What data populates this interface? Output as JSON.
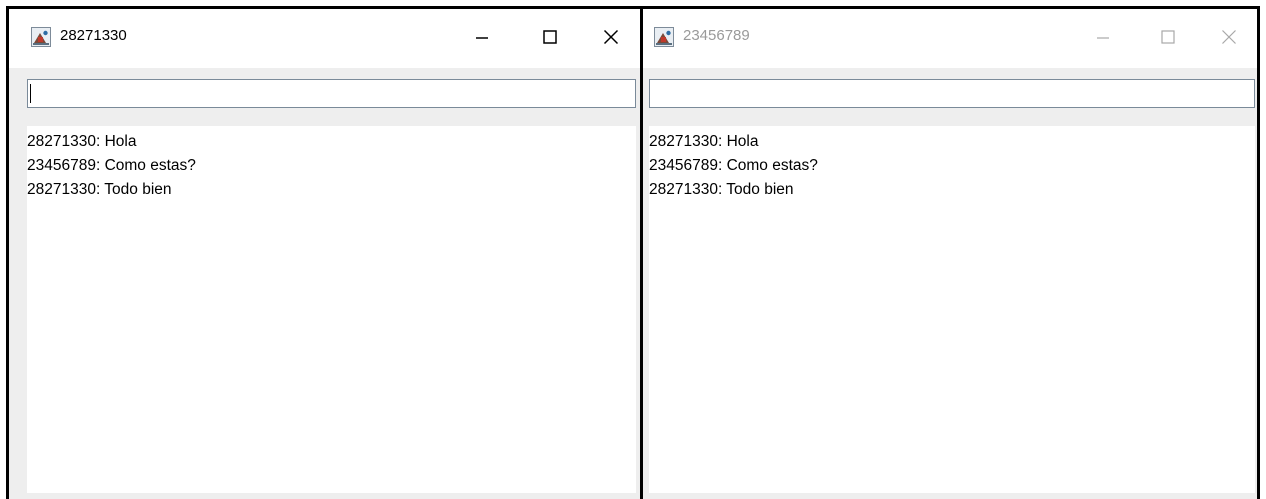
{
  "windows": [
    {
      "title": "28271330",
      "active": true,
      "input_value": "",
      "messages": [
        "28271330: Hola",
        "23456789: Como estas?",
        "28271330: Todo bien"
      ]
    },
    {
      "title": "23456789",
      "active": false,
      "input_value": "",
      "messages": [
        "28271330: Hola",
        "23456789: Como estas?",
        "28271330: Todo bien"
      ]
    }
  ],
  "icons": {
    "app": "java-app-icon",
    "minimize": "minimize-icon",
    "maximize": "maximize-icon",
    "close": "close-icon"
  },
  "colors": {
    "inactive_title": "#9a9a9a",
    "panel_background": "#eeeeee",
    "input_border": "#7a8a99"
  }
}
